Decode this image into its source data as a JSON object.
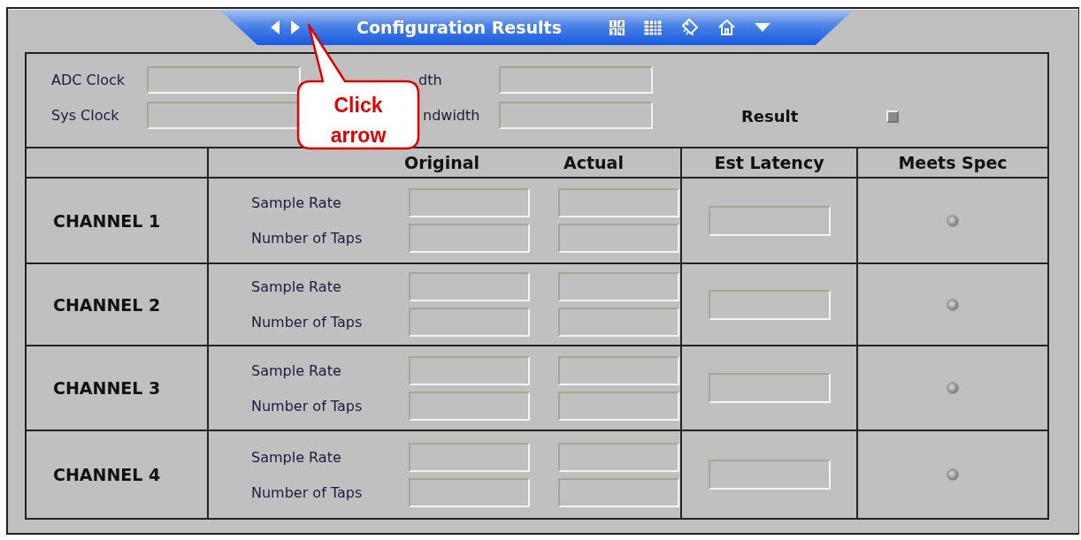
{
  "header": {
    "title": "Configuration Results"
  },
  "clocks": [
    {
      "label": "ADC Clock"
    },
    {
      "label": "Sys Clock"
    }
  ],
  "bandwidths": [
    {
      "label": "dth"
    },
    {
      "label": "ndwidth"
    }
  ],
  "result": {
    "label": "Result",
    "lit": false
  },
  "table": {
    "columns": [
      {
        "label": "Original"
      },
      {
        "label": "Actual"
      },
      {
        "label": "Est Latency"
      },
      {
        "label": "Meets Spec"
      }
    ],
    "rows": [
      {
        "channel": "CHANNEL 1",
        "params": [
          "Sample Rate",
          "Number of Taps"
        ],
        "meets_spec": false
      },
      {
        "channel": "CHANNEL 2",
        "params": [
          "Sample Rate",
          "Number of Taps"
        ],
        "meets_spec": false
      },
      {
        "channel": "CHANNEL 3",
        "params": [
          "Sample Rate",
          "Number of Taps"
        ],
        "meets_spec": false
      },
      {
        "channel": "CHANNEL 4",
        "params": [
          "Sample Rate",
          "Number of Taps"
        ],
        "meets_spec": false
      }
    ]
  },
  "callout": {
    "text": "Click arrow"
  }
}
